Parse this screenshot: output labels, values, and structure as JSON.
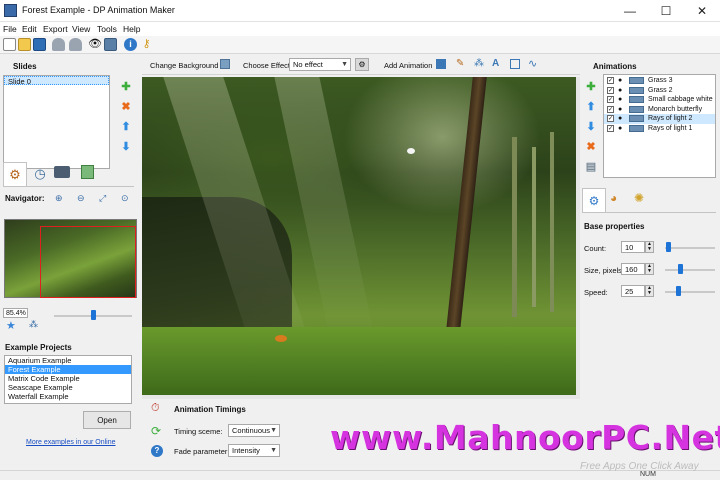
{
  "window": {
    "title": "Forest Example - DP Animation Maker",
    "controls": {
      "minimize": "—",
      "maximize": "☐",
      "close": "✕"
    }
  },
  "menu": [
    "File",
    "Edit",
    "Export",
    "View",
    "Tools",
    "Help"
  ],
  "toolbar": {
    "icons": [
      "new-file-icon",
      "open-folder-icon",
      "save-icon",
      "magnet-icon",
      "magnet-icon",
      "eye-icon",
      "film-icon",
      "info-icon",
      "key-icon"
    ]
  },
  "slides": {
    "title": "Slides",
    "items": [
      "Slide 0"
    ]
  },
  "left_tabs": [
    "settings-gear-icon",
    "clock-icon",
    "camera-icon",
    "export-icon"
  ],
  "navigator": {
    "title": "Navigator:",
    "zoom_text": "85.4%",
    "zoom_level": 0.5
  },
  "example_projects": {
    "title": "Example Projects",
    "items": [
      "Aquarium Example",
      "Forest Example",
      "Matrix Code Example",
      "Seascape Example",
      "Waterfall Example"
    ],
    "selected": "Forest Example",
    "open_label": "Open",
    "more_link": "More examples in our Online"
  },
  "canvas_toolbar": {
    "change_background": "Change Background",
    "choose_effect_label": "Choose Effect:",
    "effect_value": "No effect",
    "add_animation": "Add Animation"
  },
  "animations": {
    "title": "Animations",
    "items": [
      {
        "label": "Grass 3",
        "selected": false
      },
      {
        "label": "Grass 2",
        "selected": false
      },
      {
        "label": "Small cabbage white",
        "selected": false
      },
      {
        "label": "Monarch butterfly",
        "selected": false
      },
      {
        "label": "Rays of light 2",
        "selected": true
      },
      {
        "label": "Rays of light 1",
        "selected": false
      }
    ]
  },
  "base_properties": {
    "title": "Base properties",
    "count_label": "Count:",
    "count_value": "10",
    "size_label": "Size, pixels:",
    "size_value": "160",
    "speed_label": "Speed:",
    "speed_value": "25"
  },
  "timings": {
    "title": "Animation Timings",
    "timing_scene_label": "Timing sceme:",
    "timing_scene_value": "Continuous",
    "fade_label": "Fade parameter:",
    "fade_value": "Intensity"
  },
  "watermark": {
    "text": "www.MahnoorPC.Net",
    "tagline": "Free Apps One Click Away"
  },
  "status": {
    "num": "NUM"
  },
  "colors": {
    "selection": "#3399ff",
    "watermark": "#d633e0",
    "accent_blue": "#1e73d6"
  }
}
